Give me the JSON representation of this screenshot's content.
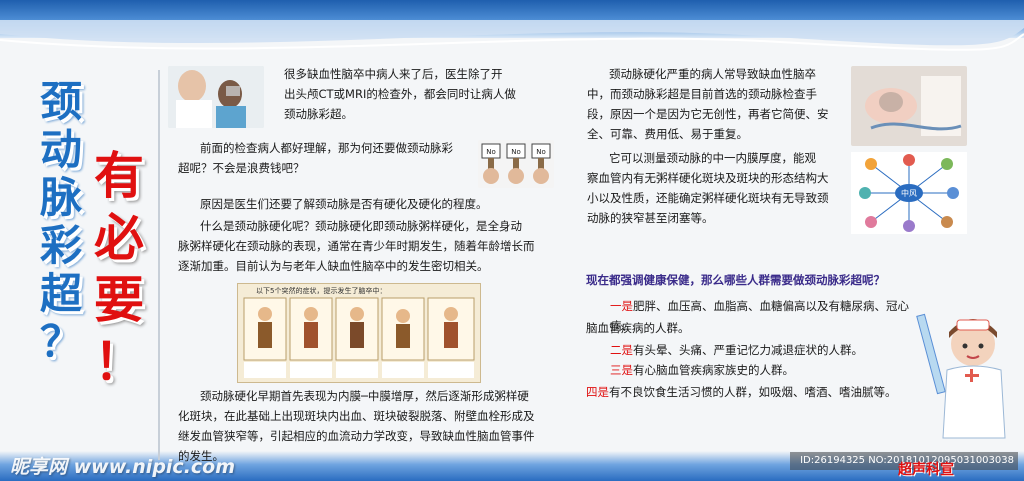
{
  "title_vertical": [
    "颈",
    "动",
    "脉",
    "彩",
    "超",
    "？"
  ],
  "title_red": [
    "有",
    "必",
    "要",
    "！"
  ],
  "left": {
    "p1": "很多缺血性脑卒中病人来了后，医生除了开出头颅CT或MRI的检查外，都会同时让病人做颈动脉彩超。",
    "p1_lines": [
      "很多缺血性脑卒中病人来了后，医生除了开",
      "出头颅CT或MRI的检查外，都会同时让病人做",
      "颈动脉彩超。"
    ],
    "p2_lines": [
      "前面的检查病人都好理解，那为何还要做颈动脉彩",
      "超呢？不会是浪费钱吧？"
    ],
    "no_signs": [
      "No",
      "No",
      "No"
    ],
    "p3": "原因是医生们还要了解颈动脉是否有硬化及硬化的程度。",
    "p4_lines": [
      "什么是颈动脉硬化呢？颈动脉硬化即颈动脉粥样硬化，是全身动",
      "脉粥样硬化在颈动脉的表现，通常在青少年时期发生，随着年龄增长而",
      "逐渐加重。目前认为与老年人缺血性脑卒中的发生密切相关。"
    ],
    "cartoon_caption": "以下5个突然的症状，提示发生了脑卒中：",
    "p5_lines": [
      "颈动脉硬化早期首先表现为内膜─中膜增厚，然后逐渐形成粥样硬",
      "化斑块，在此基础上出现斑块内出血、斑块破裂脱落、附壁血栓形成及",
      "继发血管狭窄等，引起相应的血流动力学改变，导致缺血性脑血管事件",
      "的发生。"
    ]
  },
  "right": {
    "p1_lines": [
      "颈动脉硬化严重的病人常导致缺血性脑卒",
      "中，而颈动脉彩超是目前首选的颈动脉检查手",
      "段，原因一个是因为它无创性，再者它简便、安",
      "全、可靠、费用低、易于重复。"
    ],
    "p2_lines": [
      "它可以测量颈动脉的中一内膜厚度，能观",
      "察血管内有无粥样硬化斑块及斑块的形态结构大",
      "小以及性质，还能确定粥样硬化斑块有无导致颈",
      "动脉的狭窄甚至闭塞等。"
    ],
    "diagram_center": "中风",
    "question": "现在都强调健康保健，那么哪些人群需要做颈动脉彩超呢？",
    "items": [
      {
        "num": "一是",
        "text": "肥胖、血压高、血脂高、血糖偏高以及有糖尿病、冠心病、",
        "cont": "脑血管疾病的人群。"
      },
      {
        "num": "二是",
        "text": "有头晕、头痛、严重记忆力减退症状的人群。"
      },
      {
        "num": "三是",
        "text": "有心脑血管疾病家族史的人群。"
      },
      {
        "num": "四是",
        "text": "有不良饮食生活习惯的人群，如吸烟、嗜酒、嗜油腻等。"
      }
    ]
  },
  "watermark": "昵享网 www.nipic.com",
  "image_id": "ID:26194325 NO:20181012095031003038",
  "department": "超声科宣",
  "colors": {
    "title_blue": "#1d6fc2",
    "accent_red": "#e01010",
    "question_purple": "#3a2b8a"
  }
}
